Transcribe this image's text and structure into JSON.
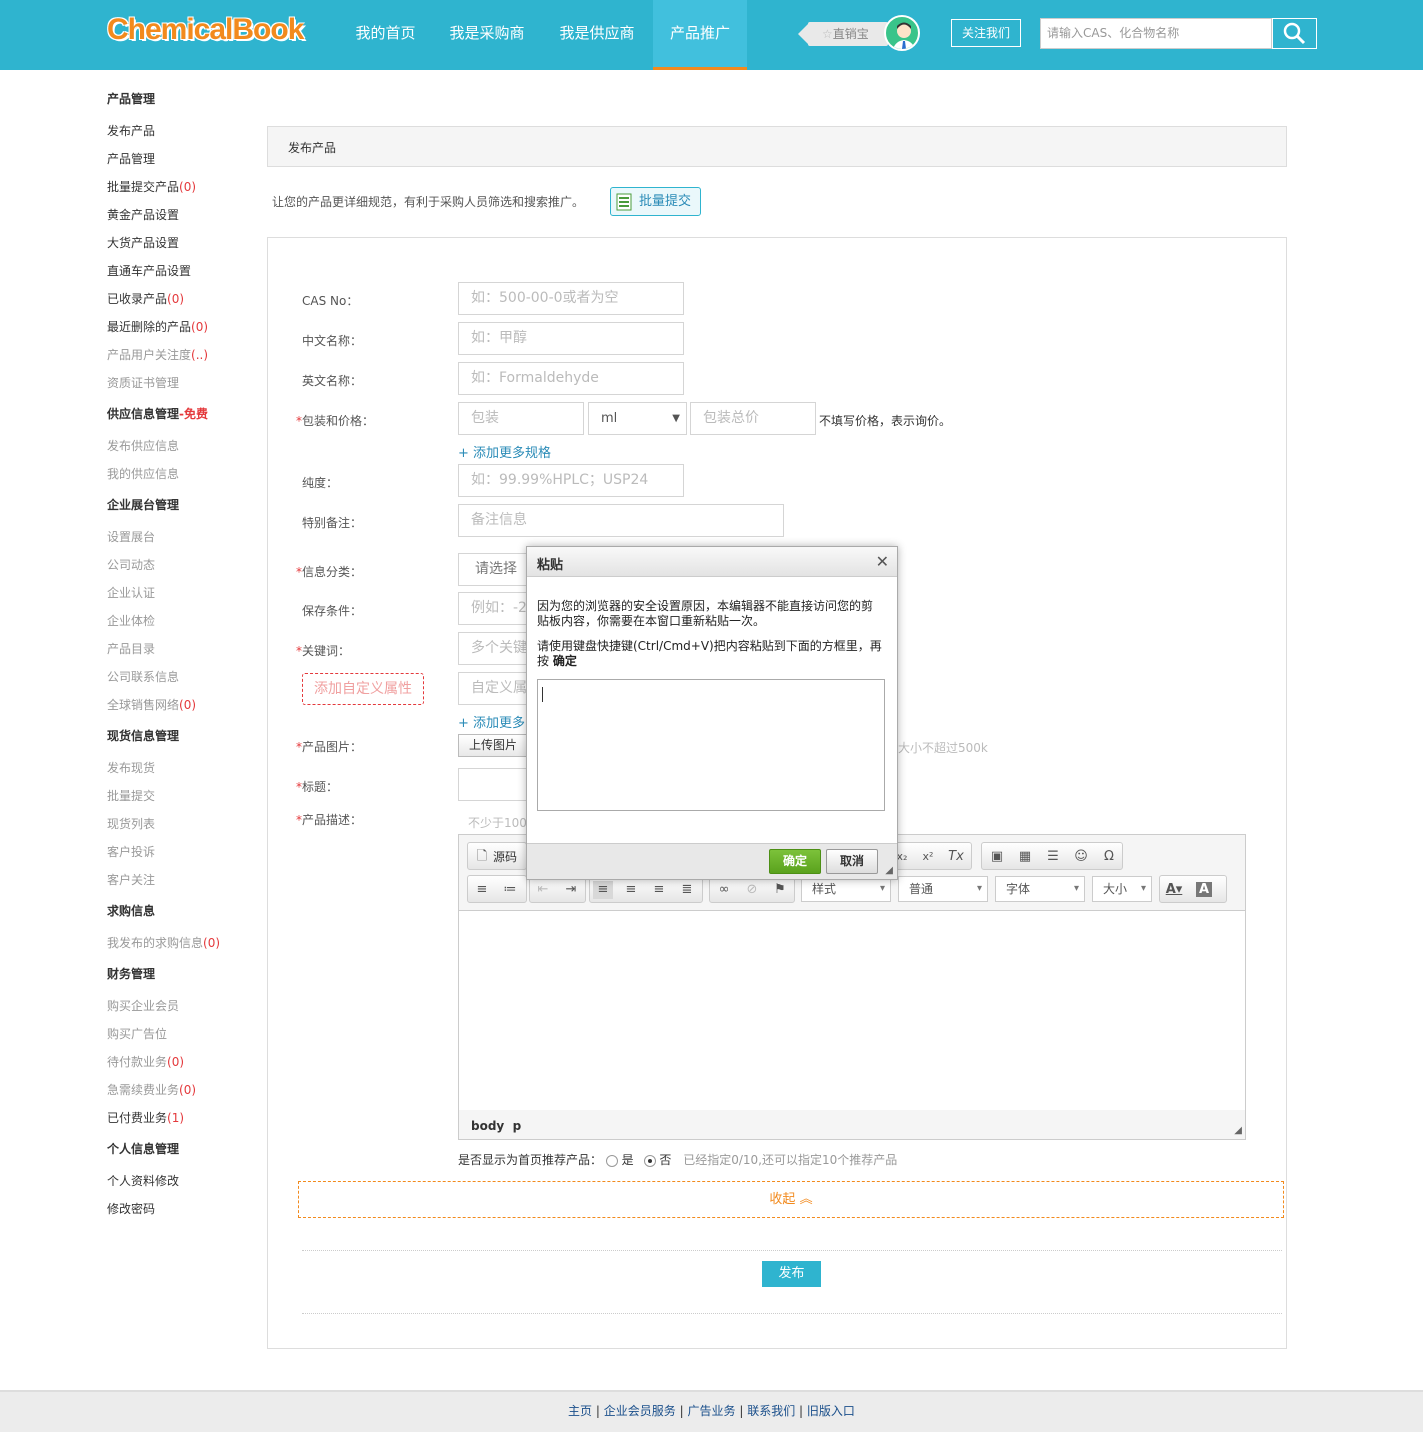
{
  "header": {
    "logo": "ChemicalBook",
    "nav": [
      "我的首页",
      "我是采购商",
      "我是供应商",
      "产品推广"
    ],
    "active_nav": "产品推广",
    "zhixiaobao": "直销宝",
    "follow": "关注我们",
    "search_placeholder": "请输入CAS、化合物名称"
  },
  "sidebar": {
    "h_product": "产品管理",
    "publish_product": "发布产品",
    "product_manage": "产品管理",
    "batch_submit": "批量提交产品",
    "batch_count": "(0)",
    "gold_product": "黄金产品设置",
    "bulk_product": "大货产品设置",
    "express_product": "直通车产品设置",
    "collected": "已收录产品",
    "collected_count": "(0)",
    "deleted": "最近删除的产品",
    "deleted_count": "(0)",
    "attention": "产品用户关注度",
    "attention_count": "(..)",
    "certificates": "资质证书管理",
    "h_supply": "供应信息管理",
    "supply_free": "-免费",
    "publish_supply": "发布供应信息",
    "my_supply": "我的供应信息",
    "h_showroom": "企业展台管理",
    "set_showroom": "设置展台",
    "company_news": "公司动态",
    "company_cert": "企业认证",
    "company_exam": "企业体检",
    "product_catalog": "产品目录",
    "company_contact": "公司联系信息",
    "global_sales": "全球销售网络",
    "global_count": "(0)",
    "h_stock": "现货信息管理",
    "publish_stock": "发布现货",
    "stock_batch": "批量提交",
    "stock_list": "现货列表",
    "complaints": "客户投诉",
    "customer_follow": "客户关注",
    "h_purchase": "求购信息",
    "my_purchase": "我发布的求购信息",
    "purchase_count": "(0)",
    "h_finance": "财务管理",
    "buy_member": "购买企业会员",
    "buy_ad": "购买广告位",
    "pending_pay": "待付款业务",
    "pending_count": "(0)",
    "renew": "急需续费业务",
    "renew_count": "(0)",
    "paid": "已付费业务",
    "paid_count": "(1)",
    "h_personal": "个人信息管理",
    "profile_edit": "个人资料修改",
    "change_password": "修改密码"
  },
  "main": {
    "title": "发布产品",
    "hint": "让您的产品更详细规范，有利于采购人员筛选和搜索推广。",
    "batch_btn": "批量提交"
  },
  "form": {
    "cas_label": "CAS No：",
    "cas_placeholder": "如：500-00-0或者为空",
    "cn_label": "中文名称：",
    "cn_placeholder": "如：甲醇",
    "en_label": "英文名称：",
    "en_placeholder": "如：Formaldehyde",
    "pack_label": "包装和价格：",
    "pack_placeholder": "包装",
    "unit": "ml",
    "total_placeholder": "包装总价",
    "pack_note": "不填写价格，表示询价。",
    "add_spec": "+ 添加更多规格",
    "purity_label": "纯度：",
    "purity_placeholder": "如：99.99%HPLC；USP24",
    "remark_label": "特别备注：",
    "remark_placeholder": "备注信息",
    "category_label": "信息分类：",
    "category_value": "请选择",
    "storage_label": "保存条件：",
    "storage_placeholder": "例如：-2",
    "keyword_label": "关键词：",
    "keyword_placeholder": "多个关键",
    "custom_attr_btn": "添加自定义属性",
    "custom_attr_placeholder": "自定义属",
    "add_more": "+ 添加更多",
    "image_label": "产品图片：",
    "upload_btn": "上传图片",
    "image_note": "大小不超过500k",
    "title_label": "标题：",
    "desc_label": "产品描述：",
    "desc_hint": "不少于100",
    "recommend_label": "是否显示为首页推荐产品：",
    "yes": "是",
    "no": "否",
    "recommend_note": "已经指定0/10,还可以指定10个推荐产品",
    "collapse": "收起",
    "publish": "发布"
  },
  "editor": {
    "source": "源码",
    "style": "样式",
    "format": "普通",
    "font": "字体",
    "size": "大小",
    "path_body": "body",
    "path_p": "p"
  },
  "dialog": {
    "title": "粘贴",
    "line1": "因为您的浏览器的安全设置原因，本编辑器不能直接访问您的剪贴板内容，你需要在本窗口重新粘贴一次。",
    "line2_a": "请使用键盘快捷键(Ctrl/Cmd+V)把内容粘贴到下面的方框里，再按",
    "line2_b": "确定",
    "ok": "确定",
    "cancel": "取消"
  },
  "footer": {
    "home": "主页",
    "member": "企业会员服务",
    "ads": "广告业务",
    "contact": "联系我们",
    "old": "旧版入口",
    "sep": "|"
  },
  "colors": {
    "brand": "#2fb4cf",
    "accent": "#f28a1d",
    "required": "#e4393c"
  }
}
